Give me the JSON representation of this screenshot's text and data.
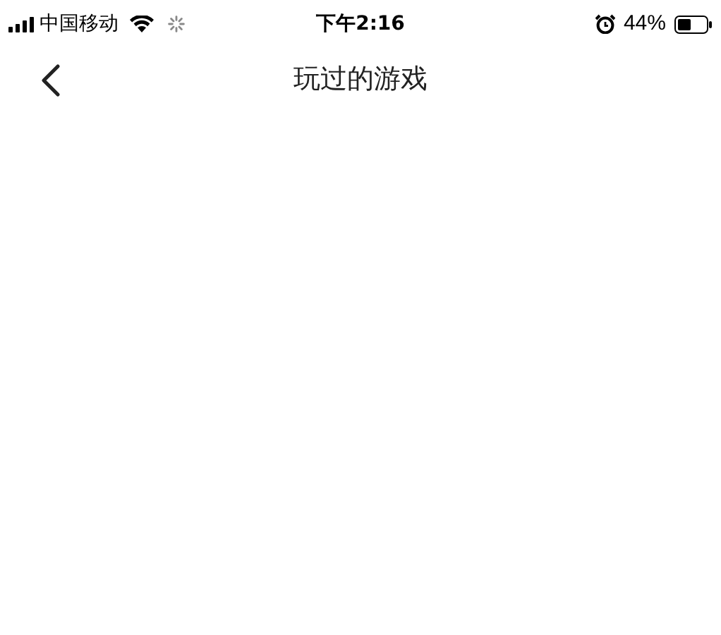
{
  "status_bar": {
    "carrier": "中国移动",
    "time": "下午2:16",
    "battery": "44%"
  },
  "nav_bar": {
    "title": "玩过的游戏"
  }
}
